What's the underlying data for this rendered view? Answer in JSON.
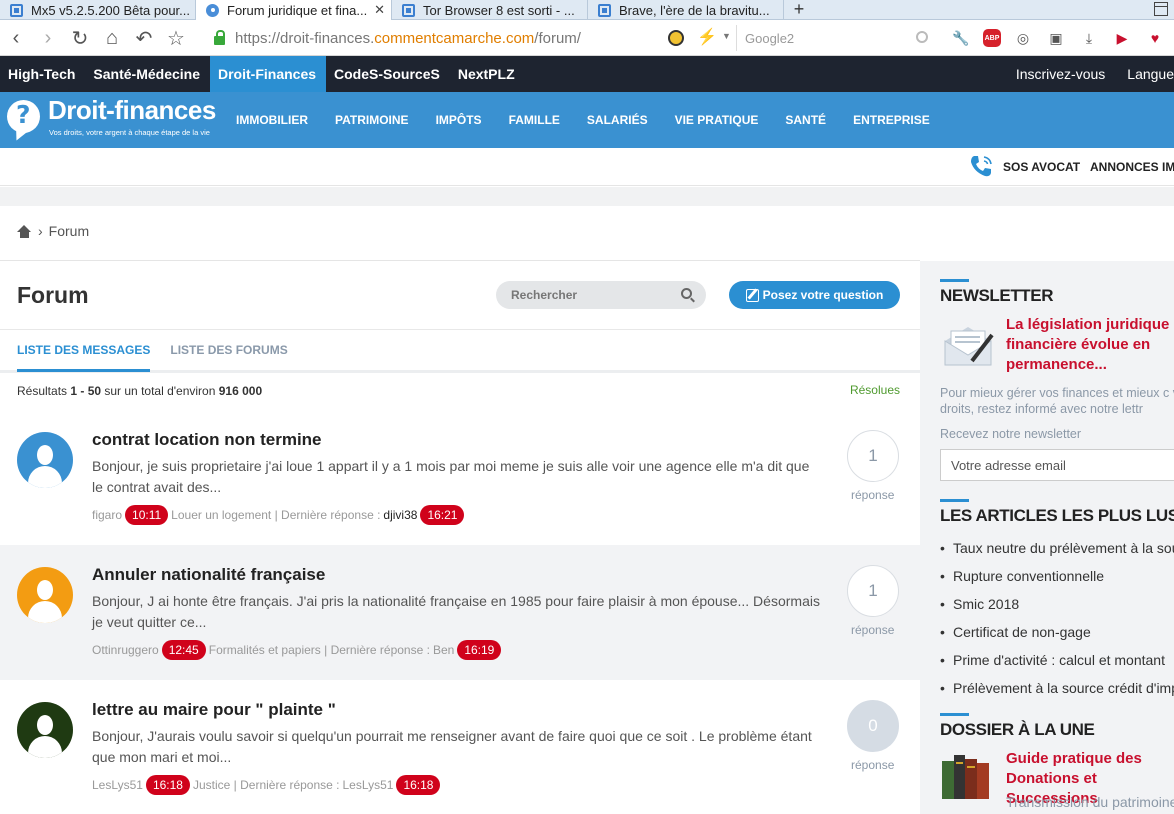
{
  "browser": {
    "tabs": [
      {
        "title": "Mx5 v5.2.5.200 Bêta pour..."
      },
      {
        "title": "Forum juridique et fina...",
        "close": "✕"
      },
      {
        "title": "Tor Browser 8 est sorti - ..."
      },
      {
        "title": "Brave, l'ère de la bravitu..."
      }
    ],
    "new_tab": "+",
    "url_scheme": "https://droit-finances.",
    "url_host": "commentcamarche.com",
    "url_path": "/forum/",
    "search_engine": "Google2"
  },
  "site_bar": {
    "items": [
      "High-Tech",
      "Santé-Médecine",
      "Droit-Finances",
      "CodeS-SourceS",
      "NextPLZ"
    ],
    "active": "Droit-Finances",
    "signup": "Inscrivez-vous",
    "language": "Langue"
  },
  "header": {
    "logo_name": "Droit-finances",
    "logo_tagline": "Vos droits, votre argent à chaque étape de la vie",
    "nav": [
      "IMMOBILIER",
      "PATRIMOINE",
      "IMPÔTS",
      "FAMILLE",
      "SALARIÉS",
      "VIE PRATIQUE",
      "SANTÉ",
      "ENTREPRISE"
    ]
  },
  "subbar": {
    "sos": "SOS AVOCAT",
    "annonces": "ANNONCES IMM"
  },
  "breadcrumb": {
    "current": "Forum",
    "sep": "›"
  },
  "forum": {
    "title": "Forum",
    "search_placeholder": "Rechercher",
    "ask_button": "Posez votre question",
    "tabs": [
      "LISTE DES MESSAGES",
      "LISTE DES FORUMS"
    ],
    "results_prefix": "Résultats ",
    "results_range": "1 - 50",
    "results_mid": " sur un total d'environ ",
    "results_total": "916 000",
    "resolues": "Résolues",
    "posts": [
      {
        "title": "contrat location non termine",
        "excerpt": "Bonjour, je suis proprietaire j'ai loue 1 appart il y a 1 mois par moi meme je suis alle voir une agence elle m'a dit que le contrat avait des...",
        "author": "figaro",
        "time": "10:11",
        "category": "Louer un logement | Dernière réponse :",
        "last_user": "djivi38",
        "last_time": "16:21",
        "replies": "1",
        "reply_label": "réponse",
        "avatar_color": "#3a91d1"
      },
      {
        "title": "Annuler nationalité française",
        "excerpt": "Bonjour, J ai honte être français. J'ai pris la nationalité française en 1985 pour faire plaisir à mon épouse... Désormais je veut quitter ce...",
        "author": "Ottinruggero",
        "time": "12:45",
        "category": "Formalités et papiers | Dernière réponse :",
        "last_user": "Ben",
        "last_time": "16:19",
        "replies": "1",
        "reply_label": "réponse",
        "avatar_color": "#f39c12"
      },
      {
        "title": "lettre au maire pour \" plainte \"",
        "excerpt": "Bonjour, J'aurais voulu savoir si quelqu'un pourrait me renseigner avant de faire quoi que ce soit . Le problème étant que mon mari et moi...",
        "author": "LesLys51",
        "time": "16:18",
        "category": "Justice | Dernière réponse :",
        "last_user": "LesLys51",
        "last_time": "16:18",
        "replies": "0",
        "reply_label": "réponse",
        "avatar_color": "#1f3a12"
      }
    ]
  },
  "sidebar": {
    "newsletter": {
      "heading": "NEWSLETTER",
      "title": "La législation juridique financière évolue en permanence...",
      "text": "Pour mieux gérer vos finances et mieux c vos droits, restez informé avec notre lettr",
      "label": "Recevez notre newsletter",
      "placeholder": "Votre adresse email"
    },
    "articles": {
      "heading": "LES ARTICLES LES PLUS LUS",
      "items": [
        "Taux neutre du prélèvement à la sou",
        "Rupture conventionnelle",
        "Smic 2018",
        "Certificat de non-gage",
        "Prime d'activité : calcul et montant",
        "Prélèvement à la source crédit d'imp"
      ]
    },
    "dossier": {
      "heading": "DOSSIER À LA UNE",
      "title": "Guide pratique des Donations et Successions",
      "subtitle": "Transmission du patrimoine"
    }
  }
}
